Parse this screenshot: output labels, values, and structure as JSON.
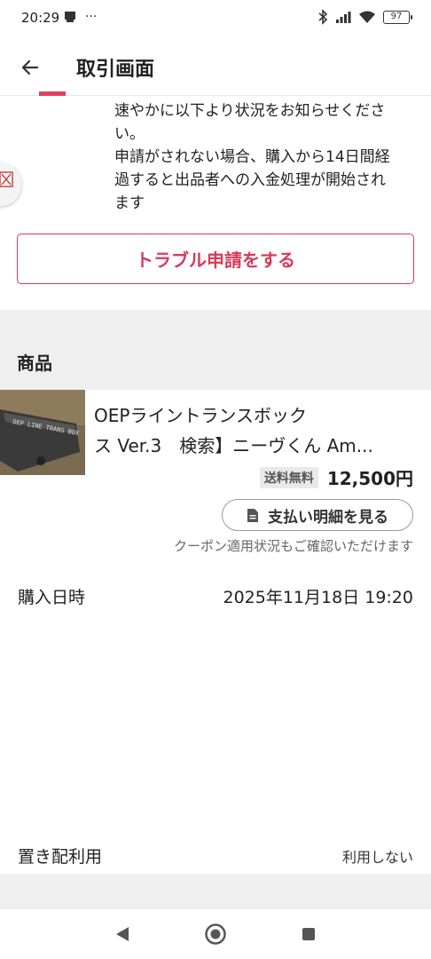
{
  "status_bar": {
    "time": "20:29",
    "overflow": "···",
    "battery": "97",
    "icons": [
      "notification-icon",
      "bluetooth-icon",
      "signal-icon",
      "wifi-icon",
      "battery-icon"
    ]
  },
  "app_bar": {
    "title": "取引画面",
    "back_icon": "arrow-left-icon"
  },
  "notice": {
    "lines": [
      "速やかに以下より状況をお知らせくださ",
      "い。",
      "申請がされない場合、購入から14日間経",
      "過すると出品者への入金処理が開始され",
      "ます"
    ]
  },
  "trouble_button": {
    "label": "トラブル申請をする"
  },
  "product_section": {
    "title": "商品",
    "name_line1": "OEPライントランスボック",
    "name_line2": "ス Ver.3　検索】ニーヴくん Am...",
    "shipping_badge": "送料無料",
    "price": "12,500円",
    "receipt_button": "支払い明細を見る",
    "coupon_note": "クーポン適用状況もご確認いただけます"
  },
  "purchase": {
    "label": "購入日時",
    "value": "2025年11月18日 19:20"
  },
  "okihai": {
    "label": "置き配利用",
    "value": "利用しない"
  },
  "colors": {
    "accent": "#d83a59",
    "separator": "#efefef"
  }
}
